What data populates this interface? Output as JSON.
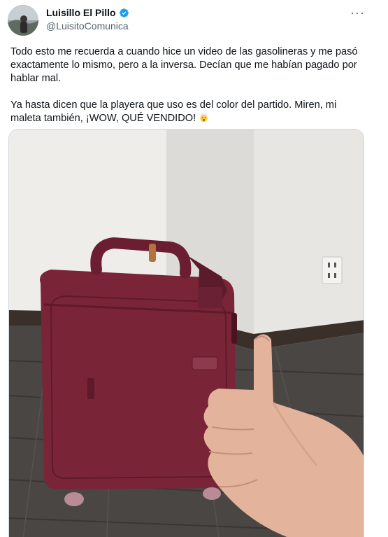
{
  "author": {
    "display_name": "Luisillo El Pillo",
    "handle": "@LuisitoComunica",
    "verified": true
  },
  "menu": {
    "more_label": "···"
  },
  "tweet": {
    "paragraph_1": "Todo esto me recuerda a cuando hice un video de las gasolineras y me pasó exactamente lo mismo, pero a la inversa. Decían que me habían pagado por hablar mal.",
    "paragraph_2": "Ya hasta dicen que la playera que uso es del color del partido. Miren, mi maleta también, ¡WOW, QUÉ VENDIDO!",
    "emoji_name": "exploding-head-emoji"
  },
  "colors": {
    "verified_blue": "#1d9bf0",
    "suitcase": "#7a2438",
    "secondary_text": "#536471"
  },
  "media": {
    "description_icon": "photo"
  }
}
